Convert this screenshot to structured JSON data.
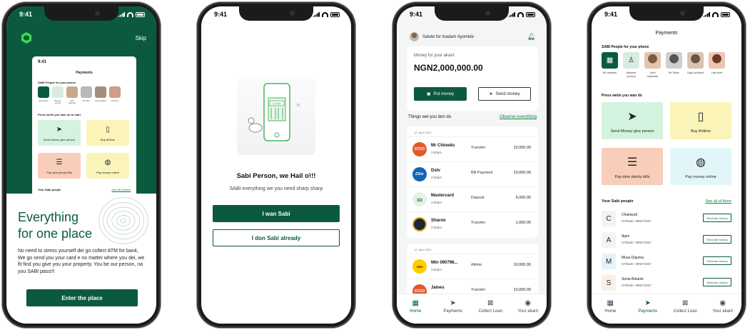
{
  "status_time": "9:41",
  "onboarding": {
    "skip": "Skip",
    "headline_line1": "Everything",
    "headline_line2": "for one place",
    "body": "No need to stress yourself dei go collect ATM for bank, We go send you your card e no matter where you dei, we fit find you give you your property. You be our person, na you SABI pass!!!",
    "cta": "Enter the place",
    "preview": {
      "time": "9:41",
      "title": "Payments",
      "people_label": "SABI People for your phone",
      "avatar_labels": [
        "All contacts",
        "Mummy yummy",
        "John carpenter",
        "Mr Tabor",
        "Oga Landlord",
        "Last born"
      ],
      "press_label": "Press wetin you wan do to start",
      "tiles": [
        "Send Money give person",
        "Buy Airtime",
        "Pay dem plenty bills",
        "Pay money online"
      ],
      "your_people": "Your Sabi people",
      "see_all": "See all of them"
    }
  },
  "welcome": {
    "illustration_sign": "BANK",
    "title": "Sabi Person, we Hail o!!!",
    "subtitle": "SABI everything we you need sharp sharp",
    "primary": "I wan Sabi",
    "secondary": "I don Sabi already"
  },
  "home": {
    "greeting": "Salute for madam Ayomide",
    "balance_label": "Money for your akant",
    "balance": "NGN2,000,000.00",
    "put_money": "Put money",
    "send_money": "Send money",
    "section": "Things wei you don do",
    "observe": "Observe everything",
    "groups": [
      {
        "date": "12, April 2022",
        "rows": [
          {
            "logo": "GTCO",
            "name": "Mr Chinedu",
            "time": "3:00pm",
            "type": "Transfer",
            "amount": "10,000.00"
          },
          {
            "logo": "DStv",
            "name": "Dstv",
            "time": "3:00pm",
            "type": "Bill Payment",
            "amount": "10,000.00"
          },
          {
            "logo": "",
            "name": "Mastercard",
            "time": "3:00pm",
            "type": "Deposit",
            "amount": "5,000.00"
          },
          {
            "logo": "",
            "name": "Sharon",
            "time": "3:00pm",
            "type": "Transfer",
            "amount": "1,000.00"
          }
        ]
      },
      {
        "date": "12, April 2022",
        "rows": [
          {
            "logo": "mtn",
            "name": "Mtn 090798...",
            "time": "3:00pm",
            "type": "Aitime",
            "amount": "10,000.00"
          },
          {
            "logo": "GTCO",
            "name": "James",
            "time": "3:00pm",
            "type": "Transfer",
            "amount": "10,000.00"
          }
        ]
      }
    ]
  },
  "payments": {
    "title": "Payments",
    "people_label": "SABI People for your phone",
    "avatars": [
      {
        "label": "All contacts"
      },
      {
        "label": "Mummy yummy"
      },
      {
        "label": "John carpenter"
      },
      {
        "label": "Mr Tabor"
      },
      {
        "label": "Oga Landlord"
      },
      {
        "label": "Last born"
      }
    ],
    "press_label": "Press wetin you wan do",
    "tiles": [
      "Send Money give person",
      "Buy Airtime",
      "Pay dem plenty bills",
      "Pay money online"
    ],
    "your_people": "Your Sabi people",
    "see_all": "See all of them",
    "people": [
      {
        "initial": "C",
        "name": "Chukwudi",
        "bank": "GTBank- 099271827",
        "action": "Send am money"
      },
      {
        "initial": "A",
        "name": "Ajani",
        "bank": "GTBank- 099271827",
        "action": "Send am money"
      },
      {
        "initial": "M",
        "name": "Musa Dajuma",
        "bank": "GTBank- 099271827",
        "action": "Send am money"
      },
      {
        "initial": "S",
        "name": "Sonia Bolanle",
        "bank": "GTBank- 099271827",
        "action": "Send am money"
      }
    ]
  },
  "tabbar": [
    "Home",
    "Payments",
    "Collect Loan",
    "Your akant"
  ],
  "colors": {
    "brand": "#0b5a3e",
    "accent_link": "#0a8a3c"
  }
}
